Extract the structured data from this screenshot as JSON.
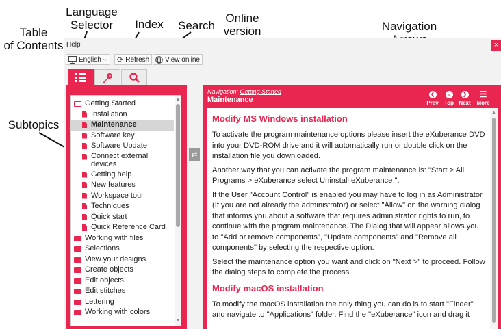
{
  "callouts": {
    "toc": "Table\nof Contents",
    "language": "Language\nSelector",
    "index": "Index",
    "search": "Search",
    "online": "Online\nversion",
    "nav_arrows": "Navigation\nArrows",
    "subtopics": "Subtopics"
  },
  "window": {
    "title": "Help",
    "close_glyph": "×"
  },
  "toolbar": {
    "language_value": "English",
    "refresh_label": "Refresh",
    "online_label": "View online"
  },
  "icons": {
    "monitor": "monitor-icon",
    "caret": "chevron-down-icon",
    "refresh": "refresh-icon",
    "globe": "globe-icon",
    "toc": "list-icon",
    "index": "key-icon",
    "search": "search-icon",
    "sync": "sync-icon",
    "prev": "arrow-left-circle-icon",
    "top": "arrow-up-circle-icon",
    "next": "arrow-right-circle-icon",
    "more": "menu-icon"
  },
  "colors": {
    "accent": "#e8264f",
    "selected_row": "#d6d6d6"
  },
  "tree": {
    "items": [
      {
        "label": "Getting Started",
        "level": 0,
        "type": "folder-open"
      },
      {
        "label": "Installation",
        "level": 1,
        "type": "doc"
      },
      {
        "label": "Maintenance",
        "level": 1,
        "type": "doc",
        "selected": true
      },
      {
        "label": "Software key",
        "level": 1,
        "type": "doc"
      },
      {
        "label": "Software Update",
        "level": 1,
        "type": "doc"
      },
      {
        "label": "Connect external devices",
        "level": 1,
        "type": "doc"
      },
      {
        "label": "Getting help",
        "level": 1,
        "type": "doc"
      },
      {
        "label": "New features",
        "level": 1,
        "type": "doc"
      },
      {
        "label": "Workspace tour",
        "level": 1,
        "type": "doc"
      },
      {
        "label": "Techniques",
        "level": 1,
        "type": "doc"
      },
      {
        "label": "Quick start",
        "level": 1,
        "type": "doc"
      },
      {
        "label": "Quick Reference Card",
        "level": 1,
        "type": "doc"
      },
      {
        "label": "Working with files",
        "level": 0,
        "type": "folder"
      },
      {
        "label": "Selections",
        "level": 0,
        "type": "folder"
      },
      {
        "label": "View your designs",
        "level": 0,
        "type": "folder"
      },
      {
        "label": "Create objects",
        "level": 0,
        "type": "folder"
      },
      {
        "label": "Edit objects",
        "level": 0,
        "type": "folder"
      },
      {
        "label": "Edit stitches",
        "level": 0,
        "type": "folder"
      },
      {
        "label": "Lettering",
        "level": 0,
        "type": "folder"
      },
      {
        "label": "Working with colors",
        "level": 0,
        "type": "folder"
      }
    ]
  },
  "navigation": {
    "prefix": "Navigation: ",
    "breadcrumb": "Getting Started",
    "page_title": "Maintenance",
    "prev_label": "Prev",
    "top_label": "Top",
    "next_label": "Next",
    "more_label": "More"
  },
  "content": {
    "heading1": "Modify MS Windows installation",
    "p1": "To activate the program maintenance options please insert the eXuberance DVD into your DVD-ROM drive and it will automatically run or double click on the installation file you downloaded.",
    "p2": "Another way that you can activate the program maintenance is: \"Start > All Programs > eXuberance select Uninstall eXuberance \".",
    "p3": "If the User \"Account Control\" is enabled you may have to log in as Administrator (If you are not already the administrator) or select \"Allow\" on the warning dialog that informs you about a software that requires administrator rights to run,  to continue with the program maintenance. The Dialog that will appear allows you to \"Add or remove components\", \"Update components\" and \"Remove all components\" by selecting the respective option.",
    "p4": "Select the maintenance option you want and click on \"Next >\" to proceed. Follow the dialog steps to complete the process.",
    "heading2": "Modify macOS installation",
    "p5": "To modify the macOS installation the only thing you can do is to start \"Finder\" and navigate to \"Applications\" folder. Find the \"eXuberance\" icon and drag it"
  }
}
